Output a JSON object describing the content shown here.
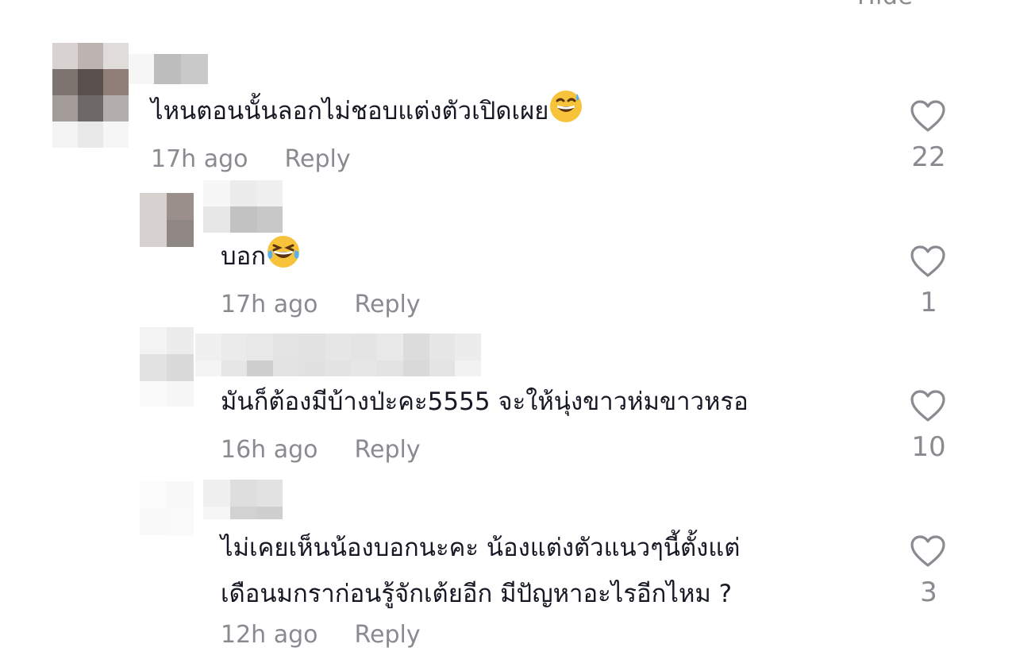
{
  "header": {
    "hide_label": "Hide ^"
  },
  "comments": [
    {
      "text": "ไหนตอนนั้นลอกไม่ชอบแต่งตัวเปิดเผย",
      "emoji": "sweat-smile-emoji",
      "time": "17h ago",
      "reply_label": "Reply",
      "likes": "22"
    },
    {
      "text": "บอก",
      "emoji": "tears-of-joy-emoji",
      "time": "17h ago",
      "reply_label": "Reply",
      "likes": "1"
    },
    {
      "text": "มันก็ต้องมีบ้างป่ะคะ5555 จะให้นุ่งขาวห่มขาวหรอ",
      "time": "16h ago",
      "reply_label": "Reply",
      "likes": "10"
    },
    {
      "text_line1": "ไม่เคยเห็นน้องบอกนะคะ น้องแต่งตัวแนวๆนี้ตั้งแต่",
      "text_line2": "เดือนมกราก่อนรู้จักเต้ยอีก มีปัญหาอะไรอีกไหม ?",
      "time": "12h ago",
      "reply_label": "Reply",
      "likes": "3"
    }
  ],
  "colors": {
    "text": "#161823",
    "muted": "#8a8b91",
    "background": "#ffffff"
  },
  "icons": {
    "like": "heart-outline-icon",
    "avatar": "blurred-avatar"
  }
}
